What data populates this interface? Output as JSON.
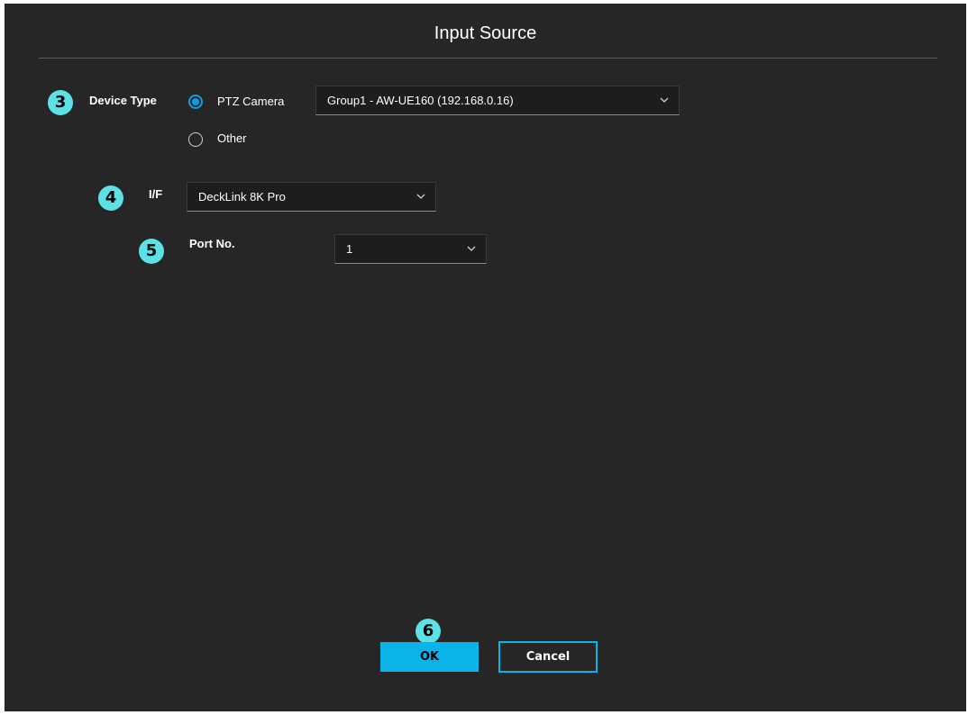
{
  "dialog": {
    "title": "Input Source"
  },
  "device_type": {
    "badge": "3",
    "label": "Device Type",
    "options": [
      {
        "label": "PTZ Camera",
        "selected": true
      },
      {
        "label": "Other",
        "selected": false
      }
    ],
    "camera_select_value": "Group1 - AW-UE160 (192.168.0.16)"
  },
  "interface": {
    "badge": "4",
    "label": "I/F",
    "select_value": "DeckLink 8K Pro"
  },
  "port": {
    "badge": "5",
    "label": "Port No.",
    "select_value": "1"
  },
  "footer": {
    "badge": "6",
    "ok_label": "OK",
    "cancel_label": "Cancel"
  },
  "colors": {
    "background": "#262626",
    "accent": "#0ab4e8",
    "badge": "#5ce1e6"
  },
  "icons": {
    "dropdown": "chevron-down-icon"
  }
}
